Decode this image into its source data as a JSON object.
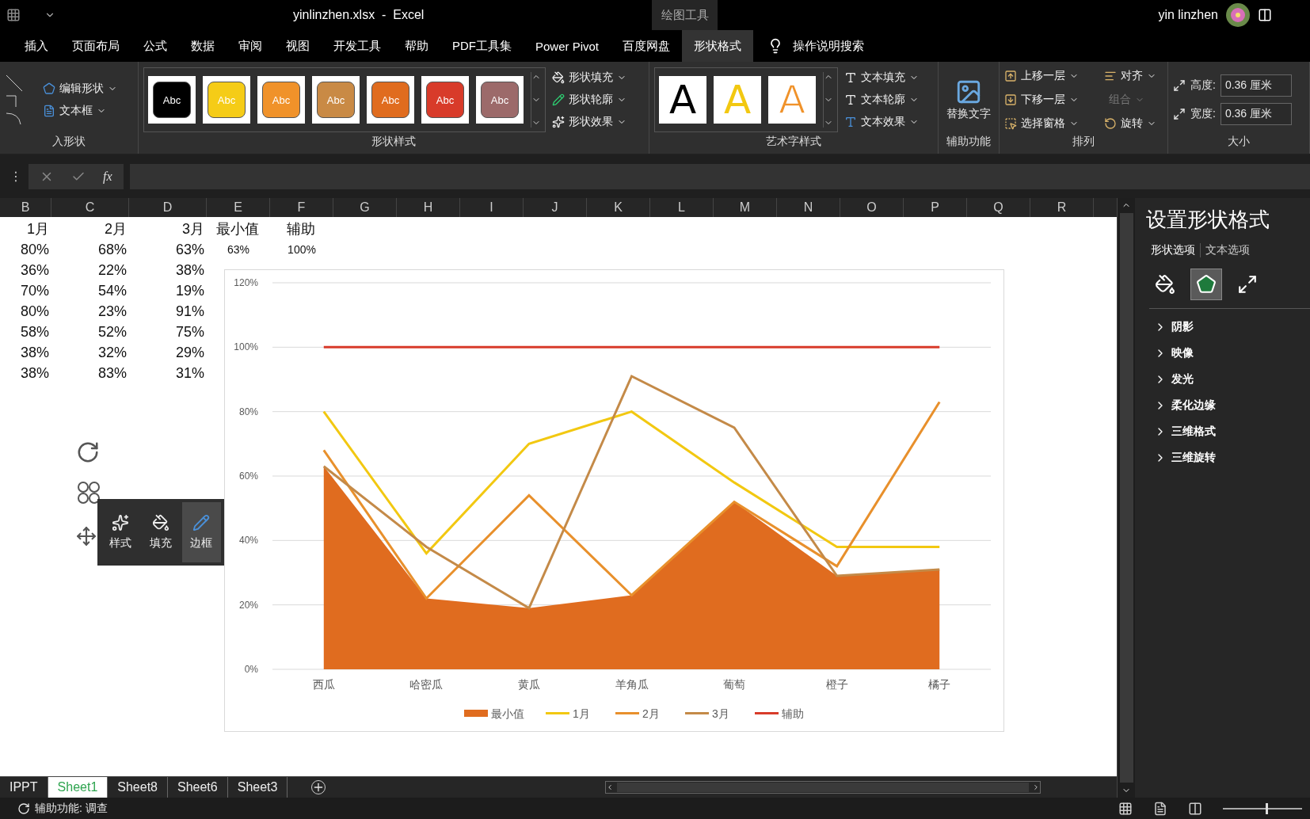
{
  "title_bar": {
    "file_title": "yinlinzhen.xlsx  -  Excel",
    "context_label": "绘图工具",
    "user_name": "yin linzhen"
  },
  "tabs": [
    {
      "label": "插入",
      "selected": false
    },
    {
      "label": "页面布局",
      "selected": false
    },
    {
      "label": "公式",
      "selected": false
    },
    {
      "label": "数据",
      "selected": false
    },
    {
      "label": "审阅",
      "selected": false
    },
    {
      "label": "视图",
      "selected": false
    },
    {
      "label": "开发工具",
      "selected": false
    },
    {
      "label": "帮助",
      "selected": false
    },
    {
      "label": "PDF工具集",
      "selected": false
    },
    {
      "label": "Power Pivot",
      "selected": false
    },
    {
      "label": "百度网盘",
      "selected": false
    },
    {
      "label": "形状格式",
      "selected": true
    }
  ],
  "tell_me": "操作说明搜索",
  "insert_shapes": {
    "buttons": [
      "编辑形状",
      "文本框"
    ],
    "label": "入形状"
  },
  "shape_styles": {
    "swatches": [
      {
        "label": "Abc",
        "color": "#000000"
      },
      {
        "label": "Abc",
        "color": "#f5cc17"
      },
      {
        "label": "Abc",
        "color": "#f0922a"
      },
      {
        "label": "Abc",
        "color": "#c98a45"
      },
      {
        "label": "Abc",
        "color": "#e06c1f"
      },
      {
        "label": "Abc",
        "color": "#d83b2a"
      },
      {
        "label": "Abc",
        "color": "#9c6a6a"
      }
    ],
    "buttons": [
      "形状填充",
      "形状轮廓",
      "形状效果"
    ],
    "label": "形状样式"
  },
  "wordart_styles": {
    "samples": [
      {
        "label": "A",
        "kind": "fill",
        "color": "#000000"
      },
      {
        "label": "A",
        "kind": "fill",
        "color": "#f2c811"
      },
      {
        "label": "A",
        "kind": "outline",
        "color": "#f0922a"
      }
    ],
    "buttons": [
      "文本填充",
      "文本轮廓",
      "文本效果"
    ],
    "label": "艺术字样式"
  },
  "accessibility": {
    "button": "替换文字",
    "label": "辅助功能"
  },
  "arrange": {
    "buttons": [
      {
        "label": "上移一层",
        "disabled": false
      },
      {
        "label": "对齐",
        "disabled": false
      },
      {
        "label": "下移一层",
        "disabled": false
      },
      {
        "label": "组合",
        "disabled": true
      },
      {
        "label": "选择窗格",
        "disabled": false
      },
      {
        "label": "旋转",
        "disabled": false
      }
    ],
    "label": "排列"
  },
  "size": {
    "fields": [
      {
        "label": "高度:",
        "value": "0.36 厘米"
      },
      {
        "label": "宽度:",
        "value": "0.36 厘米"
      }
    ],
    "label": "大小"
  },
  "formula_bar": {
    "menu": "⋮",
    "function": "fx"
  },
  "sheet": {
    "columns": [
      "B",
      "C",
      "D",
      "E",
      "F",
      "G",
      "H",
      "I",
      "J",
      "K",
      "L",
      "M",
      "N",
      "O",
      "P",
      "Q",
      "R"
    ],
    "rows": [
      [
        "1月",
        "2月",
        "3月",
        "最小值",
        "辅助"
      ],
      [
        "80%",
        "68%",
        "63%",
        "63%",
        "100%"
      ],
      [
        "36%",
        "22%",
        "38%"
      ],
      [
        "70%",
        "54%",
        "19%"
      ],
      [
        "80%",
        "23%",
        "91%"
      ],
      [
        "58%",
        "52%",
        "75%"
      ],
      [
        "38%",
        "32%",
        "29%"
      ],
      [
        "38%",
        "83%",
        "31%"
      ]
    ]
  },
  "chart": {
    "chart_data": {
      "type": "line",
      "categories": [
        "西瓜",
        "哈密瓜",
        "黄瓜",
        "羊角瓜",
        "葡萄",
        "橙子",
        "橘子"
      ],
      "series": [
        {
          "name": "最小值",
          "color": "#e06c1f",
          "type": "area",
          "values": [
            0.63,
            0.22,
            0.19,
            0.23,
            0.52,
            0.29,
            0.31
          ]
        },
        {
          "name": "1月",
          "color": "#f2c811",
          "type": "line",
          "values": [
            0.8,
            0.36,
            0.7,
            0.8,
            0.58,
            0.38,
            0.38
          ]
        },
        {
          "name": "2月",
          "color": "#e8902c",
          "type": "line",
          "values": [
            0.68,
            0.22,
            0.54,
            0.23,
            0.52,
            0.32,
            0.83
          ]
        },
        {
          "name": "3月",
          "color": "#c48a48",
          "type": "line",
          "values": [
            0.63,
            0.38,
            0.19,
            0.91,
            0.75,
            0.29,
            0.31
          ]
        },
        {
          "name": "辅助",
          "color": "#d83b2a",
          "type": "line",
          "values": [
            1,
            1,
            1,
            1,
            1,
            1,
            1
          ]
        }
      ],
      "ylim": [
        0,
        1.2
      ],
      "grid": true,
      "legend": "bottom",
      "yticks": [
        {
          "value": 0,
          "label": "0%"
        },
        {
          "value": 0.2,
          "label": "20%"
        },
        {
          "value": 0.4,
          "label": "40%"
        },
        {
          "value": 0.6,
          "label": "60%"
        },
        {
          "value": 0.8,
          "label": "80%"
        },
        {
          "value": 1,
          "label": "100%"
        },
        {
          "value": 1.2,
          "label": "120%"
        }
      ]
    }
  },
  "mini_toolbar": [
    {
      "label": "样式",
      "selected": false
    },
    {
      "label": "填充",
      "selected": false
    },
    {
      "label": "边框",
      "selected": true
    }
  ],
  "format_pane": {
    "title": "设置形状格式",
    "tabs": [
      {
        "label": "形状选项",
        "selected": true
      },
      {
        "label": "文本选项",
        "selected": false
      }
    ],
    "icon_tabs": [
      {
        "kind": "fill",
        "selected": false
      },
      {
        "kind": "effects",
        "selected": true
      },
      {
        "kind": "size",
        "selected": false
      }
    ],
    "sections": [
      {
        "label": "阴影",
        "expanded": false
      },
      {
        "label": "映像",
        "expanded": false
      },
      {
        "label": "发光",
        "expanded": false
      },
      {
        "label": "柔化边缘",
        "expanded": false
      },
      {
        "label": "三维格式",
        "expanded": false
      },
      {
        "label": "三维旋转",
        "expanded": false
      }
    ]
  },
  "sheet_tabs": [
    {
      "label": "IPPT",
      "selected": false
    },
    {
      "label": "Sheet1",
      "selected": true
    },
    {
      "label": "Sheet8",
      "selected": false
    },
    {
      "label": "Sheet6",
      "selected": false
    },
    {
      "label": "Sheet3",
      "selected": false
    }
  ],
  "status_bar": {
    "accessibility": "辅助功能: 调查",
    "zoom": {
      "level": 0.55
    }
  }
}
